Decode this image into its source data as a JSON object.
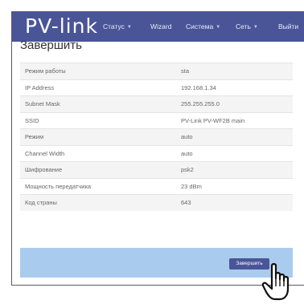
{
  "navbar": {
    "logo": "PV-link",
    "items": [
      {
        "label": "Статус",
        "caret": "▼"
      },
      {
        "label": "Wizard"
      },
      {
        "label": "Система",
        "caret": "▼"
      },
      {
        "label": "Сеть",
        "caret": "▼"
      },
      {
        "label": "Выйти"
      }
    ]
  },
  "page": {
    "title": "Завершить",
    "rows": [
      {
        "label": "Режим работы",
        "value": "sta"
      },
      {
        "label": "IP Address",
        "value": "192.168.1.34"
      },
      {
        "label": "Subnet Mask",
        "value": "255.255.255.0"
      },
      {
        "label": "SSID",
        "value": "PV-Link PV-WF2B main"
      },
      {
        "label": "Режим",
        "value": "auto"
      },
      {
        "label": "Channel Width",
        "value": "auto"
      },
      {
        "label": "Шифрование",
        "value": "psk2"
      },
      {
        "label": "Мощность передатчика",
        "value": "23 dBm"
      },
      {
        "label": "Код страны",
        "value": "643"
      }
    ],
    "finish_button": "Завершить"
  },
  "colors": {
    "navbar": "#4a5598",
    "footer": "#a9cbee",
    "button": "#4a5598"
  },
  "icons": {
    "cursor": "hand-pointer-icon"
  }
}
